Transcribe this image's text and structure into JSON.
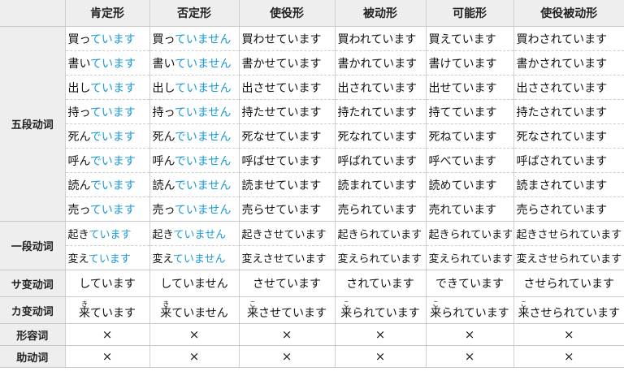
{
  "headers": [
    "",
    "肯定形",
    "否定形",
    "使役形",
    "被动形",
    "可能形",
    "使役被动形"
  ],
  "groups": {
    "godan": "五段动词",
    "ichidan": "一段动词",
    "sahen": "サ变动词",
    "kahen": "カ变动词",
    "adjective": "形容词",
    "auxiliary": "助动词"
  },
  "godan_rows": [
    {
      "aff_stem": "買っ",
      "aff_end": "ています",
      "neg_stem": "買っ",
      "neg_end": "ていません",
      "causative": "買わせています",
      "passive": "買われています",
      "potential": "買えています",
      "caus_passive": "買わされています"
    },
    {
      "aff_stem": "書い",
      "aff_end": "ています",
      "neg_stem": "書い",
      "neg_end": "ていません",
      "causative": "書かせています",
      "passive": "書かれています",
      "potential": "書けています",
      "caus_passive": "書かされています"
    },
    {
      "aff_stem": "出し",
      "aff_end": "ています",
      "neg_stem": "出し",
      "neg_end": "ていません",
      "causative": "出させています",
      "passive": "出されています",
      "potential": "出せています",
      "caus_passive": "出さされています"
    },
    {
      "aff_stem": "持っ",
      "aff_end": "ています",
      "neg_stem": "持っ",
      "neg_end": "ていません",
      "causative": "持たせています",
      "passive": "持たれています",
      "potential": "持てています",
      "caus_passive": "持たされています"
    },
    {
      "aff_stem": "死ん",
      "aff_end": "でいます",
      "neg_stem": "死ん",
      "neg_end": "でいません",
      "causative": "死なせています",
      "passive": "死なれています",
      "potential": "死ねています",
      "caus_passive": "死なされています"
    },
    {
      "aff_stem": "呼ん",
      "aff_end": "でいます",
      "neg_stem": "呼ん",
      "neg_end": "でいません",
      "causative": "呼ばせています",
      "passive": "呼ばれています",
      "potential": "呼べています",
      "caus_passive": "呼ばされています"
    },
    {
      "aff_stem": "読ん",
      "aff_end": "でいます",
      "neg_stem": "読ん",
      "neg_end": "でいません",
      "causative": "読ませています",
      "passive": "読まれています",
      "potential": "読めています",
      "caus_passive": "読まされています"
    },
    {
      "aff_stem": "売っ",
      "aff_end": "ています",
      "neg_stem": "売っ",
      "neg_end": "ていません",
      "causative": "売らせています",
      "passive": "売られています",
      "potential": "売れています",
      "caus_passive": "売らされています"
    }
  ],
  "ichidan_rows": [
    {
      "aff_stem": "起き",
      "aff_end": "ています",
      "neg_stem": "起き",
      "neg_end": "ていません",
      "causative": "起きさせています",
      "passive": "起きられています",
      "potential": "起きられています",
      "caus_passive": "起きさせられています"
    },
    {
      "aff_stem": "変え",
      "aff_end": "ています",
      "neg_stem": "変え",
      "neg_end": "ていません",
      "causative": "変えさせています",
      "passive": "変えられています",
      "potential": "変えられています",
      "caus_passive": "変えさせられています"
    }
  ],
  "sahen_row": {
    "aff": "しています",
    "neg": "していません",
    "causative": "させています",
    "passive": "されています",
    "potential": "できています",
    "caus_passive": "させられています"
  },
  "kahen_row": {
    "aff_kanji": "来",
    "aff_ruby": "き",
    "aff_rest": "ています",
    "neg_kanji": "来",
    "neg_ruby": "き",
    "neg_rest": "ていません",
    "causative_kanji": "来",
    "causative_ruby": "こ",
    "causative_rest": "させています",
    "passive_kanji": "来",
    "passive_ruby": "こ",
    "passive_rest": "られています",
    "potential_kanji": "来",
    "potential_ruby": "こ",
    "potential_rest": "られています",
    "caus_passive_kanji": "来",
    "caus_passive_ruby": "こ",
    "caus_passive_rest": "させられています"
  },
  "not_applicable": "×",
  "colors": {
    "highlight": "#1a9ad6",
    "header_bg": "#eeeeee",
    "text": "#111111"
  }
}
